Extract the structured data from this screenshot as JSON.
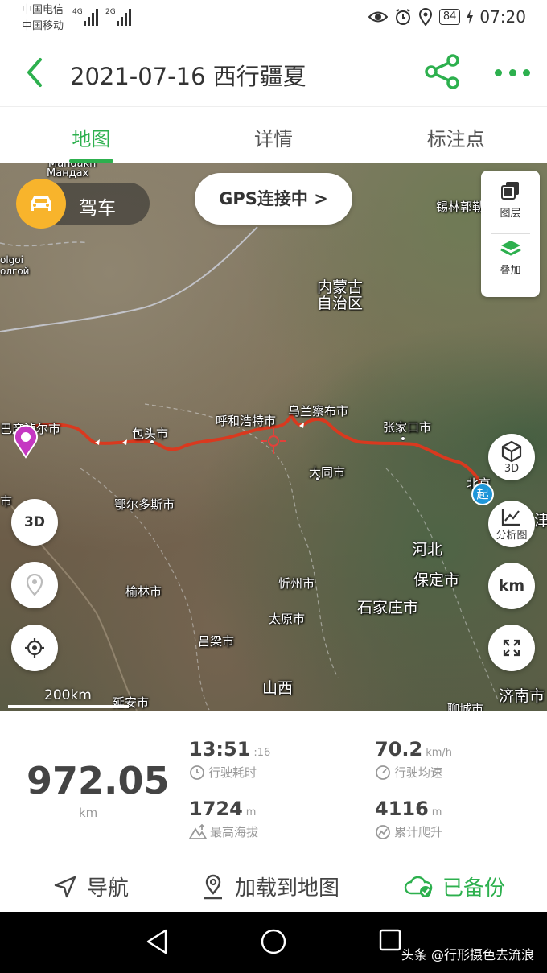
{
  "status_bar": {
    "carrier_1": "中国电信",
    "carrier_2": "中国移动",
    "network_1": "4G",
    "network_2": "2G",
    "battery": "84",
    "time": "07:20",
    "icons": [
      "eye-icon",
      "alarm-icon",
      "location-icon",
      "charging-icon"
    ]
  },
  "header": {
    "title": "2021-07-16 西行疆夏",
    "icons": [
      "back-icon",
      "share-icon",
      "more-icon"
    ],
    "accent_color": "#2db04e"
  },
  "tabs": [
    {
      "label": "地图",
      "active": true
    },
    {
      "label": "详情",
      "active": false
    },
    {
      "label": "标注点",
      "active": false
    }
  ],
  "map": {
    "mode_label": "驾车",
    "gps_status": "GPS连接中 >",
    "layers_label": "图层",
    "overlay_label": "叠加",
    "btn_3d_right": "3D",
    "btn_analysis": "分析图",
    "btn_unit": "km",
    "btn_3d_left": "3D",
    "scale_label": "200km",
    "start_marker": "起",
    "route_color": "#d9391f",
    "places": {
      "mandakh": "Мандах",
      "mandakh_latin": "Mandakh",
      "olgoi": "olgoi",
      "olgoi_cyr": "олгой",
      "xilinhot": "锡林郭勒",
      "inner_mongolia_1": "内蒙古",
      "inner_mongolia_2": "自治区",
      "bayannur": "巴彦淖尔市",
      "baotou": "包头市",
      "hohhot": "呼和浩特市",
      "ulanqab": "乌兰察布市",
      "zhangjiakou": "张家口市",
      "datong": "大同市",
      "ordos": "鄂尔多斯市",
      "beijing": "北京",
      "tianjin": "津",
      "hebei": "河北",
      "baoding": "保定市",
      "yulin": "榆林市",
      "xinzhou": "忻州市",
      "shijiazhuang": "石家庄市",
      "taiyuan": "太原市",
      "lvliang": "吕梁市",
      "shanxi": "山西",
      "yanan": "延安市",
      "jinan": "济南市",
      "liaocheng": "聊城市",
      "west_edge_city": "市"
    }
  },
  "stats": {
    "distance": {
      "value": "972.05",
      "unit": "km"
    },
    "duration": {
      "value": "13:51",
      "sub": ":16",
      "label": "行驶耗时"
    },
    "avg_speed": {
      "value": "70.2",
      "unit": "km/h",
      "label": "行驶均速"
    },
    "max_altitude": {
      "value": "1724",
      "unit": "m",
      "label": "最高海拔"
    },
    "total_climb": {
      "value": "4116",
      "unit": "m",
      "label": "累计爬升"
    }
  },
  "actions": {
    "navigate": "导航",
    "load_to_map": "加载到地图",
    "backed_up": "已备份"
  },
  "nav_bar": {
    "watermark": "头条 @行形摄色去流浪"
  }
}
